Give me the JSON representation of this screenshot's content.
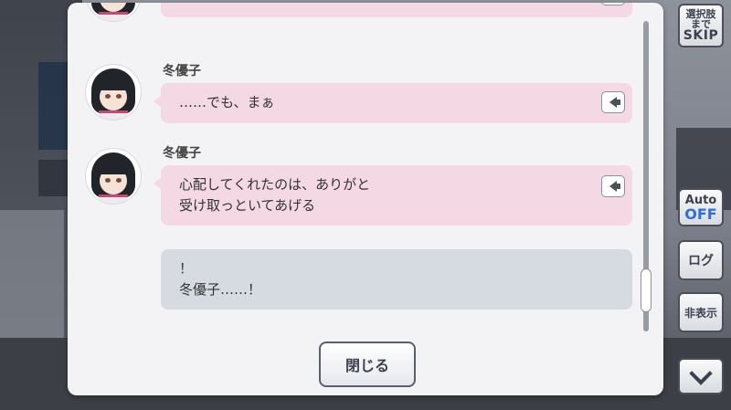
{
  "side_buttons": {
    "skip_line1": "選択肢",
    "skip_line2": "まで",
    "skip_line3": "SKIP",
    "auto_label": "Auto",
    "auto_state": "OFF",
    "log_label": "ログ",
    "hide_label": "非表示"
  },
  "log": {
    "entries": [
      {
        "speaker": "",
        "text": "……"
      },
      {
        "speaker": "冬優子",
        "text": "……でも、まぁ"
      },
      {
        "speaker": "冬優子",
        "line1": "心配してくれたのは、ありがと",
        "line2": "受け取っといてあげる"
      },
      {
        "speaker": "",
        "line1": "！",
        "line2": "冬優子……！"
      }
    ],
    "close_label": "閉じる"
  },
  "icons": {
    "voice": "speaker-icon",
    "down": "chevron-down-icon"
  },
  "colors": {
    "speaker_bubble": "#f4d8e3",
    "player_bubble": "#d6dbe2",
    "auto_off": "#2f6fd1"
  }
}
